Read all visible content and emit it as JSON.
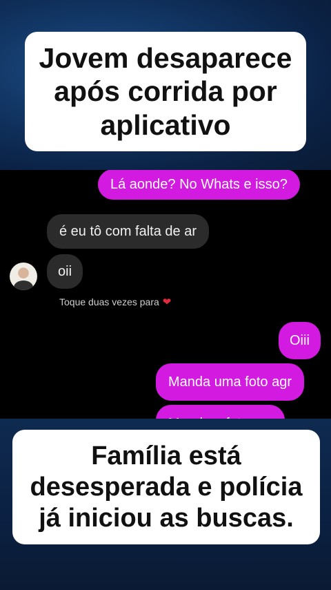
{
  "headline_top": "Jovem desaparece após corrida por aplicativo",
  "headline_bottom": "Família está desesperada e polícia já iniciou as buscas.",
  "chat": {
    "messages": [
      {
        "side": "out",
        "text": "Lá aonde? No Whats e isso?"
      },
      {
        "side": "in",
        "text": "é eu tô com falta de ar"
      },
      {
        "side": "in",
        "text": "oii"
      },
      {
        "side": "out",
        "text": "Oiii"
      },
      {
        "side": "out",
        "text": "Manda uma foto agr"
      },
      {
        "side": "out",
        "text": "Manda a foto agr"
      }
    ],
    "reaction_hint": "Toque duas vezes para",
    "reaction_icon": "heart-icon"
  },
  "colors": {
    "outgoing_bubble": "#d31ae0",
    "incoming_bubble": "#2b2b2b",
    "heart": "#e32a3a"
  }
}
